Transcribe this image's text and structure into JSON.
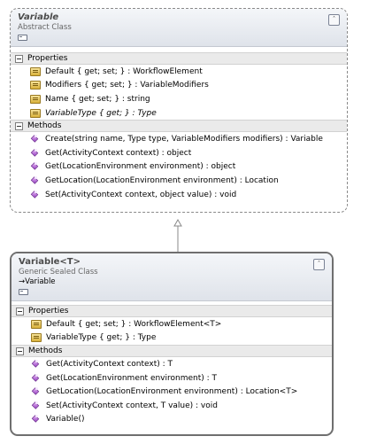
{
  "classes": [
    {
      "name": "Variable",
      "stereotype": "Abstract Class",
      "sections": {
        "properties_label": "Properties",
        "properties": [
          {
            "text": "Default { get; set; } : WorkflowElement",
            "italic": false
          },
          {
            "text": "Modifiers { get; set; } : VariableModifiers",
            "italic": false
          },
          {
            "text": "Name { get; set; } : string",
            "italic": false
          },
          {
            "text": "VariableType { get; } : Type",
            "italic": true
          }
        ],
        "methods_label": "Methods",
        "methods": [
          {
            "text": "Create(string name, Type type, VariableModifiers modifiers) : Variable",
            "italic": false
          },
          {
            "text": "Get(ActivityContext context) : object",
            "italic": false
          },
          {
            "text": "Get(LocationEnvironment environment) : object",
            "italic": false
          },
          {
            "text": "GetLocation(LocationEnvironment environment) : Location",
            "italic": false
          },
          {
            "text": "Set(ActivityContext context, object value) : void",
            "italic": false
          }
        ]
      },
      "collapse_glyph": "chevron-up-icon"
    },
    {
      "name": "Variable<T>",
      "stereotype": "Generic Sealed Class",
      "base_class": "→Variable",
      "sections": {
        "properties_label": "Properties",
        "properties": [
          {
            "text": "Default { get; set; } : WorkflowElement<T>",
            "italic": false
          },
          {
            "text": "VariableType { get; } : Type",
            "italic": false
          }
        ],
        "methods_label": "Methods",
        "methods": [
          {
            "text": "Get(ActivityContext context) : T",
            "italic": false
          },
          {
            "text": "Get(LocationEnvironment environment) : T",
            "italic": false
          },
          {
            "text": "GetLocation(LocationEnvironment environment) : Location<T>",
            "italic": false
          },
          {
            "text": "Set(ActivityContext context, T value) : void",
            "italic": false
          },
          {
            "text": "Variable()",
            "italic": false
          }
        ]
      },
      "collapse_glyph": "chevron-up-icon"
    }
  ],
  "relationship": {
    "type": "inheritance",
    "from": "Variable<T>",
    "to": "Variable"
  },
  "colors": {
    "header_top": "#f4f6f9",
    "header_bottom": "#dfe3ea",
    "section_bg": "#eaeaea",
    "border": "#8e8e8e"
  }
}
